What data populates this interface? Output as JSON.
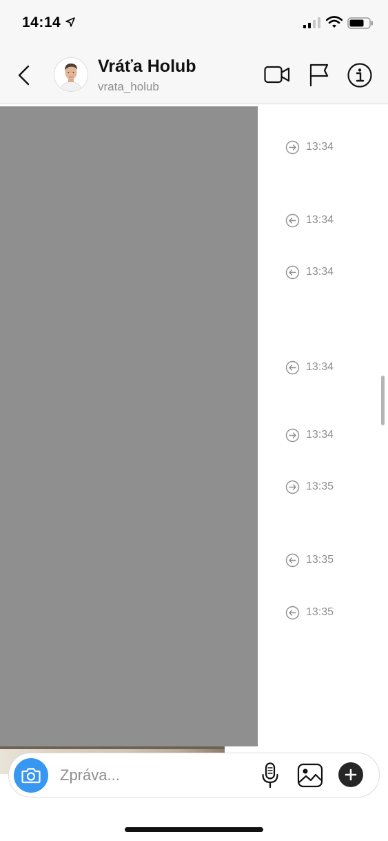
{
  "status_bar": {
    "time": "14:14",
    "icons": [
      "location-arrow-icon",
      "signal-icon",
      "wifi-icon",
      "battery-icon"
    ]
  },
  "header": {
    "contact_name": "Vráťa Holub",
    "contact_handle": "vrata_holub",
    "icons": [
      "back-icon",
      "video-call-icon",
      "flag-icon",
      "info-icon"
    ]
  },
  "messages": [
    {
      "direction": "outgoing",
      "time": "13:34"
    },
    {
      "direction": "incoming",
      "time": "13:34"
    },
    {
      "direction": "incoming",
      "time": "13:34"
    },
    {
      "direction": "incoming",
      "time": "13:34"
    },
    {
      "direction": "outgoing",
      "time": "13:34"
    },
    {
      "direction": "outgoing",
      "time": "13:35"
    },
    {
      "direction": "incoming",
      "time": "13:35"
    },
    {
      "direction": "incoming",
      "time": "13:35"
    }
  ],
  "composer": {
    "placeholder": "Zpráva...",
    "value": "",
    "icons": [
      "camera-icon",
      "microphone-icon",
      "gallery-icon",
      "plus-icon"
    ]
  },
  "colors": {
    "accent": "#3897f0",
    "bar_background": "#f7f7f7",
    "gray_block": "#8f8f8f",
    "muted_text": "#8e8e8e"
  }
}
